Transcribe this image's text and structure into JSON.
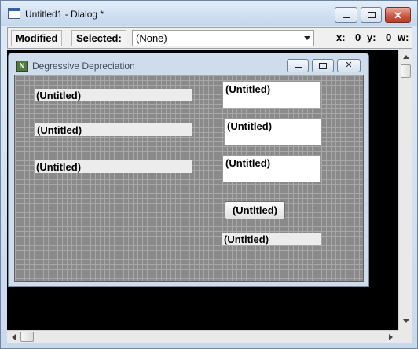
{
  "window": {
    "title": "Untitled1 - Dialog *"
  },
  "toolbar": {
    "modified_label": "Modified",
    "selected_label": "Selected:",
    "selected_value": "(None)",
    "x_label": "x:",
    "x_value": "0",
    "y_label": "y:",
    "y_value": "0",
    "w_label": "w:"
  },
  "dialog": {
    "title": "Degressive Depreciation",
    "icon_letter": "N",
    "controls": {
      "label_1": "(Untitled)",
      "label_2": "(Untitled)",
      "label_3": "(Untitled)",
      "edit_1": "(Untitled)",
      "edit_2": "(Untitled)",
      "edit_3": "(Untitled)",
      "button": "(Untitled)",
      "label_4": "(Untitled)"
    }
  },
  "colors": {
    "canvas": "#000000",
    "grid_background": "#8a8a8a",
    "grid_lines": "#a8a8a8",
    "close_button": "#c9533e"
  }
}
